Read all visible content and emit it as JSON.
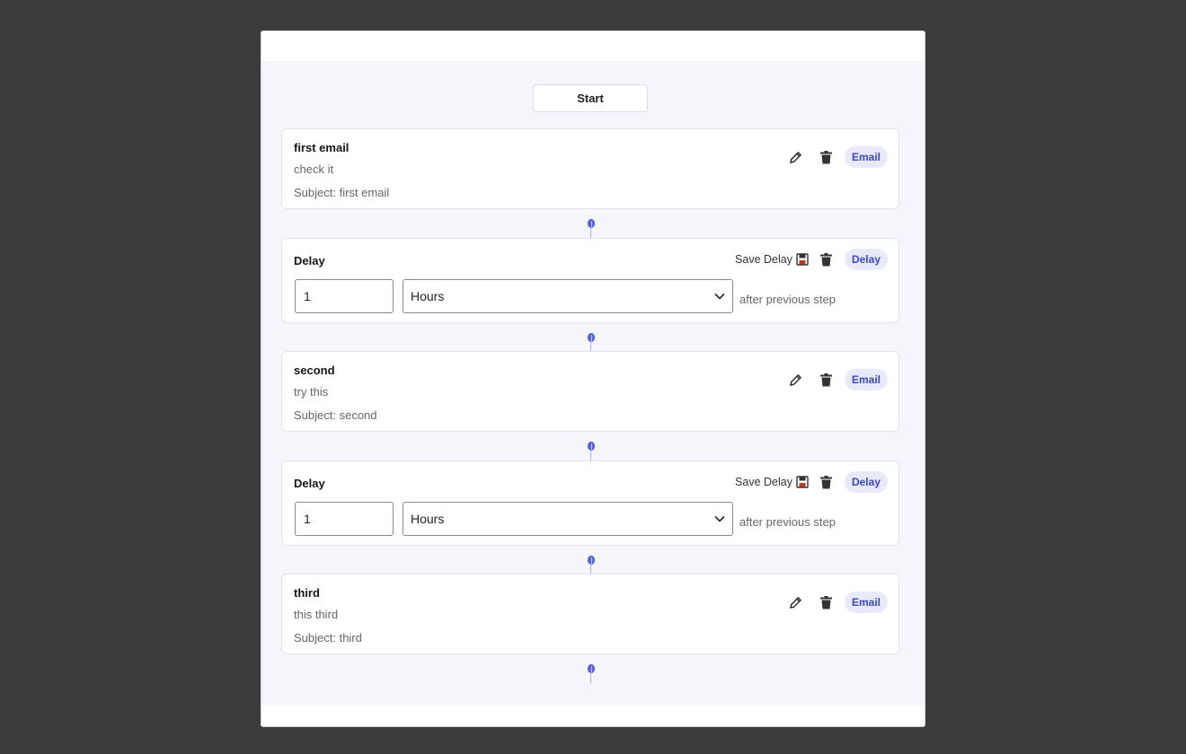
{
  "start_label": "Start",
  "steps": [
    {
      "type": "email",
      "title": "first email",
      "body": "check it",
      "subject": "Subject: first email",
      "badge": "Email"
    },
    {
      "type": "delay",
      "title": "Delay",
      "save_label": "Save Delay",
      "value": "1",
      "unit": "Hours",
      "after": "after previous step",
      "badge": "Delay"
    },
    {
      "type": "email",
      "title": "second",
      "body": "try this",
      "subject": "Subject: second",
      "badge": "Email"
    },
    {
      "type": "delay",
      "title": "Delay",
      "save_label": "Save Delay",
      "value": "1",
      "unit": "Hours",
      "after": "after previous step",
      "badge": "Delay"
    },
    {
      "type": "email",
      "title": "third",
      "body": "this third",
      "subject": "Subject: third",
      "badge": "Email"
    }
  ],
  "icons": {
    "edit": "pencil-icon",
    "delete": "trash-icon",
    "save": "save-icon",
    "dropdown": "chevron-down-icon",
    "connector": "handle-icon"
  },
  "colors": {
    "accent": "#5a63e6",
    "badge_bg": "#e8e9fb",
    "badge_text": "#3b46c9",
    "canvas": "#f5f5fb"
  }
}
